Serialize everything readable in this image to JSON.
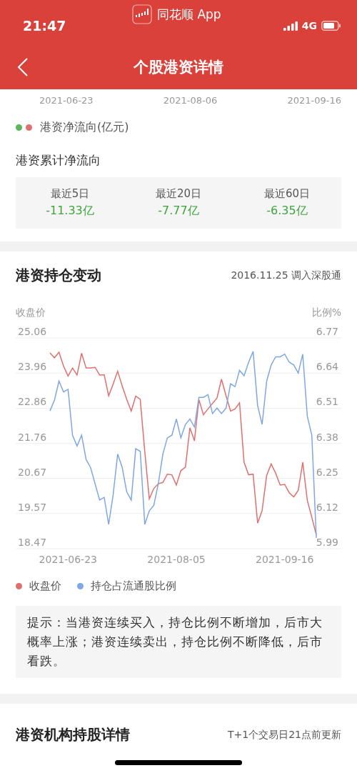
{
  "status_bar": {
    "time": "21:47",
    "app_name": "同花顺 App",
    "network": "4G"
  },
  "nav": {
    "title": "个股港资详情"
  },
  "flow_section": {
    "dates": [
      "2021-06-23",
      "2021-08-06",
      "2021-09-16"
    ],
    "legend": {
      "markers": [
        {
          "color": "#5cb85c"
        },
        {
          "color": "#e07070"
        }
      ],
      "label": "港资净流向(亿元)"
    },
    "cumulative_title": "港资累计净流向",
    "stats": [
      {
        "label": "最近5日",
        "value": "-11.33亿"
      },
      {
        "label": "最近20日",
        "value": "-7.77亿"
      },
      {
        "label": "最近60日",
        "value": "-6.35亿"
      }
    ]
  },
  "holding_section": {
    "title": "港资持仓变动",
    "note": "2016.11.25 调入深股通",
    "left_axis_label": "收盘价",
    "right_axis_label": "比例%",
    "chart_data": {
      "type": "line",
      "grid": true,
      "categories": [
        null,
        null,
        null,
        null,
        "2021-06-23",
        null,
        null,
        null,
        null,
        null,
        null,
        null,
        null,
        null,
        null,
        null,
        null,
        null,
        null,
        null,
        null,
        null,
        null,
        null,
        null,
        null,
        null,
        null,
        "2021-08-05",
        null,
        null,
        null,
        null,
        null,
        null,
        null,
        null,
        null,
        null,
        null,
        null,
        null,
        null,
        null,
        null,
        null,
        null,
        null,
        null,
        null,
        null,
        null,
        "2021-09-16",
        null,
        null,
        null,
        null,
        null,
        null,
        null
      ],
      "ylim": [
        18.47,
        25.06
      ],
      "yticks": [
        {
          "value": 18.47,
          "label": "18.47"
        },
        {
          "value": 19.57,
          "label": "19.57"
        },
        {
          "value": 20.67,
          "label": "20.67"
        },
        {
          "value": 21.76,
          "label": "21.76"
        },
        {
          "value": 22.86,
          "label": "22.86"
        },
        {
          "value": 23.96,
          "label": "23.96"
        },
        {
          "value": 25.06,
          "label": "25.06"
        }
      ],
      "y2lim": [
        5.99,
        6.77
      ],
      "y2ticks": [
        {
          "value": 5.99,
          "label": "5.99"
        },
        {
          "value": 6.12,
          "label": "6.12"
        },
        {
          "value": 6.25,
          "label": "6.25"
        },
        {
          "value": 6.38,
          "label": "6.38"
        },
        {
          "value": 6.51,
          "label": "6.51"
        },
        {
          "value": 6.64,
          "label": "6.64"
        },
        {
          "value": 6.77,
          "label": "6.77"
        }
      ],
      "series": [
        {
          "name": "收盘价",
          "color": "#e07070",
          "axis": "y",
          "values": [
            24.59,
            24.44,
            24.61,
            24.18,
            23.87,
            24.12,
            23.9,
            24.58,
            24.12,
            24.12,
            24.14,
            23.9,
            23.91,
            23.25,
            23.62,
            24.02,
            23.55,
            23.14,
            22.77,
            23.24,
            23.14,
            21.5,
            20.03,
            20.35,
            20.5,
            20.54,
            20.8,
            20.78,
            20.46,
            20.91,
            21.02,
            22.25,
            21.84,
            23.13,
            22.66,
            22.84,
            23.01,
            23.18,
            23.77,
            23.25,
            22.77,
            22.84,
            23.03,
            21.17,
            20.78,
            20.8,
            19.27,
            19.66,
            20.76,
            21.12,
            20.83,
            20.46,
            20.48,
            20.22,
            20.09,
            20.29,
            21.17,
            19.98,
            19.45,
            18.9
          ]
        },
        {
          "name": "持仓占流通股比例",
          "color": "#7fa7e3",
          "axis": "y2",
          "values": [
            6.5,
            6.54,
            6.61,
            6.57,
            6.58,
            6.41,
            6.37,
            6.41,
            6.32,
            6.29,
            6.23,
            6.17,
            6.18,
            6.08,
            6.19,
            6.34,
            6.29,
            6.2,
            6.17,
            6.36,
            6.35,
            6.08,
            6.13,
            6.15,
            6.23,
            6.34,
            6.4,
            6.41,
            6.47,
            6.4,
            6.45,
            6.47,
            6.44,
            6.55,
            6.55,
            6.56,
            6.49,
            6.51,
            6.49,
            6.51,
            6.6,
            6.59,
            6.65,
            6.63,
            6.68,
            6.72,
            6.52,
            6.45,
            6.61,
            6.67,
            6.7,
            6.7,
            6.71,
            6.68,
            6.67,
            6.64,
            6.71,
            6.48,
            6.41,
            6.03
          ]
        }
      ]
    },
    "tip": "提示：当港资连续买入，持仓比例不断增加，后市大概率上涨；港资连续卖出，持仓比例不断降低，后市看跌。"
  },
  "institution_section": {
    "title": "港资机构持股详情",
    "note": "T+1个交易日21点前更新"
  }
}
